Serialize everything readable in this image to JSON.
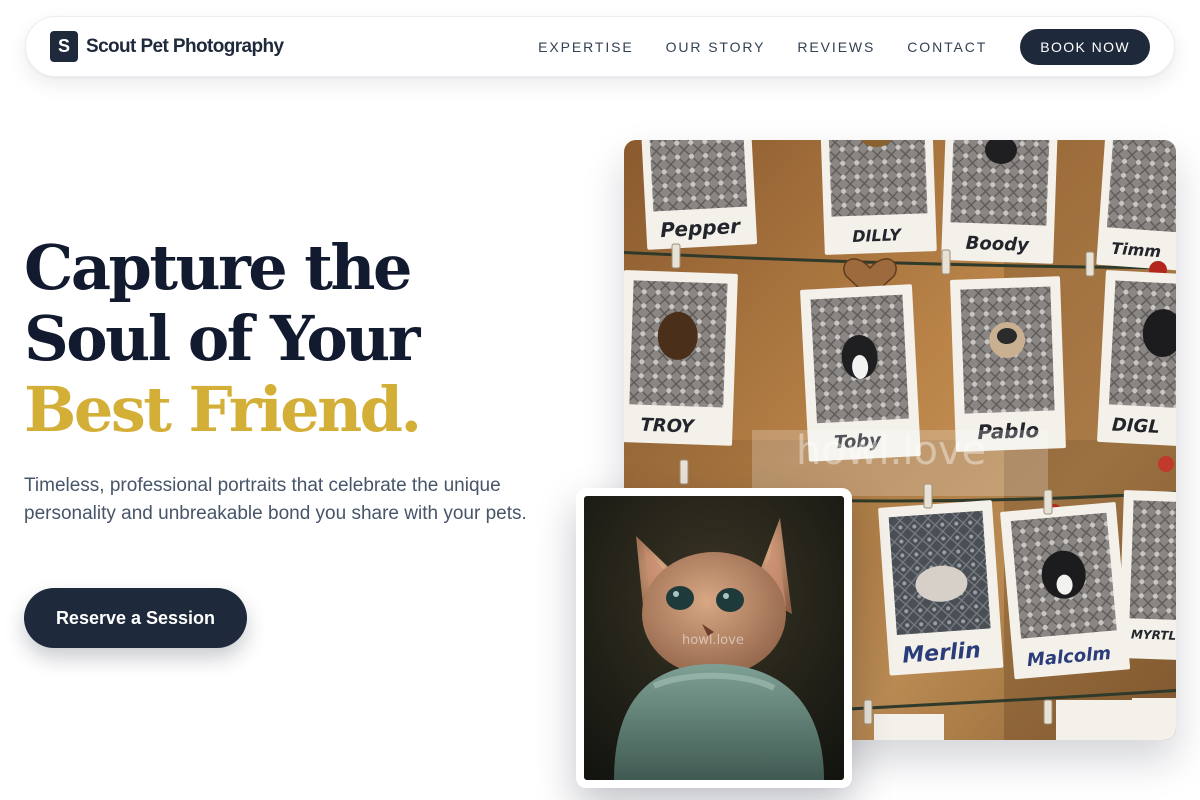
{
  "brand": {
    "mark": "S",
    "name": "Scout Pet Photography"
  },
  "nav": {
    "links": [
      "EXPERTISE",
      "OUR STORY",
      "REVIEWS",
      "CONTACT"
    ],
    "cta": "BOOK NOW"
  },
  "hero": {
    "title_line1": "Capture the",
    "title_line2": "Soul of Your",
    "title_accent": "Best Friend.",
    "subtitle": "Timeless, professional portraits that celebrate the unique personality and unbreakable bond you share with your pets.",
    "cta": "Reserve a Session"
  },
  "gallery": {
    "polaroid_labels": [
      "Pepper",
      "DILLY",
      "Boody",
      "Timm",
      "TROY",
      "Toby",
      "Pablo",
      "DIGL",
      "Merlin",
      "Malcolm",
      "MYRTLE A"
    ],
    "watermark": "howl.love"
  },
  "inset": {
    "watermark": "howl.love"
  },
  "colors": {
    "primary": "#1e293b",
    "accent": "#d4af37",
    "heading": "#111a2e",
    "body_text": "#475569"
  }
}
